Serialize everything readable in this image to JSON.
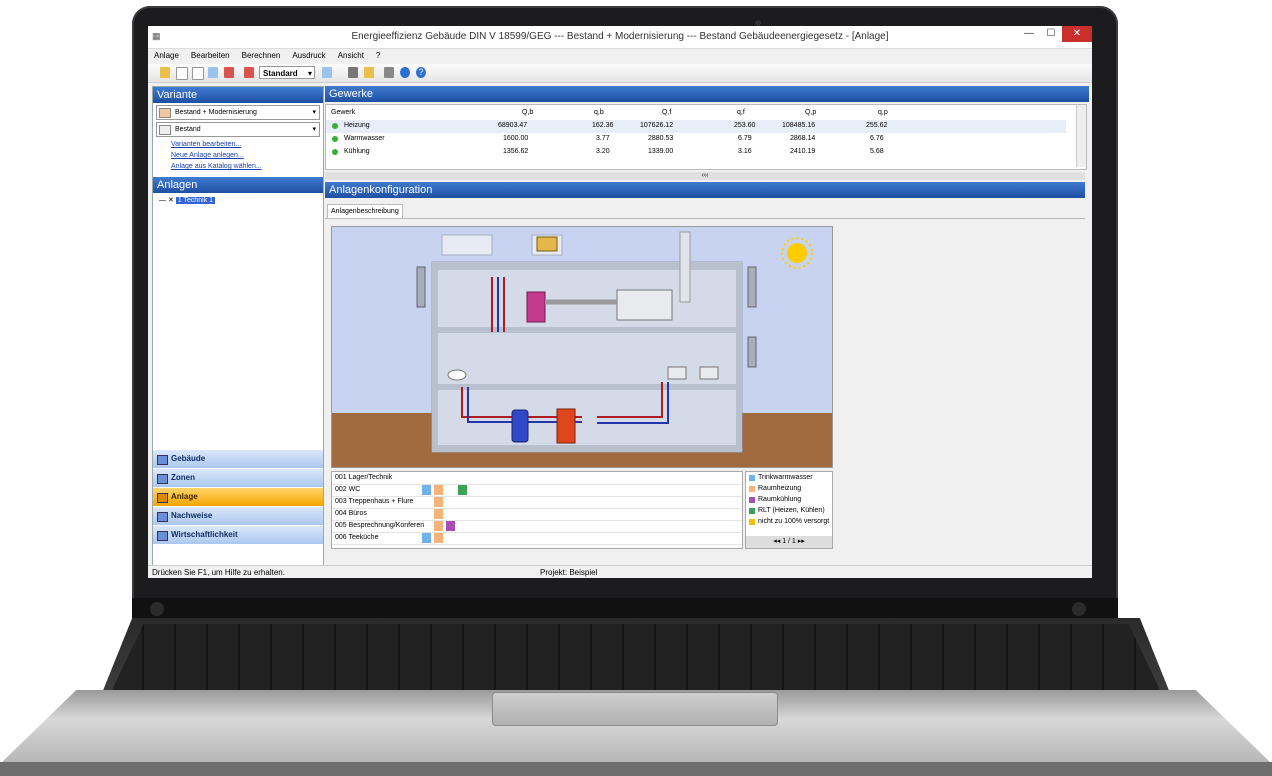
{
  "window": {
    "title": "Energieeffizienz Gebäude DIN V 18599/GEG --- Bestand + Modernisierung --- Bestand Gebäudeenergiegesetz - [Anlage]",
    "minimize": "—",
    "maximize": "☐",
    "close": "✕"
  },
  "menu": [
    "Anlage",
    "Bearbeiten",
    "Berechnen",
    "Ausdruck",
    "Ansicht",
    "?"
  ],
  "toolbar": {
    "combo_value": "Standard"
  },
  "left": {
    "variante_title": "Variante",
    "variante_select": "Bestand + Modernisierung",
    "bestand_select": "Bestand",
    "links": [
      "Varianten bearbeiten...",
      "Neue Anlage anlegen...",
      "Anlage aus Katalog wählen..."
    ],
    "anlagen_title": "Anlagen",
    "tree_node": "1 Technik 1",
    "nav": [
      "Gebäude",
      "Zonen",
      "Anlage",
      "Nachweise",
      "Wirtschaftlichkeit"
    ],
    "nav_active": "Anlage"
  },
  "gewerke": {
    "title": "Gewerke",
    "columns": [
      "Gewerk",
      "Q,b",
      "q,b",
      "Q,f",
      "q,f",
      "Q,p",
      "q,p"
    ],
    "rows": [
      {
        "name": "Heizung",
        "vals": [
          "68903.47",
          "162.36",
          "107626.12",
          "253.60",
          "108485.16",
          "255.62"
        ]
      },
      {
        "name": "Warmwasser",
        "vals": [
          "1600.00",
          "3.77",
          "2880.53",
          "6.79",
          "2868.14",
          "6.76"
        ]
      },
      {
        "name": "Kühlung",
        "vals": [
          "1356.62",
          "3.20",
          "1339.00",
          "3.16",
          "2410.19",
          "5.68"
        ]
      }
    ],
    "splitter": "‹‹‹"
  },
  "konfig": {
    "title": "Anlagenkonfiguration",
    "tab": "Anlagenbeschreibung"
  },
  "zones": [
    {
      "name": "001 Lager/Technik",
      "cells": []
    },
    {
      "name": "002 WC",
      "cells": [
        "tw",
        "rh",
        "",
        "",
        "rlt"
      ]
    },
    {
      "name": "003 Treppenhaus + Flure",
      "cells": [
        "",
        "rh"
      ]
    },
    {
      "name": "004 Büros",
      "cells": [
        "",
        "rh"
      ]
    },
    {
      "name": "005 Besprechnung/Konferen",
      "cells": [
        "",
        "rh",
        "rk"
      ]
    },
    {
      "name": "006 Teeküche",
      "cells": [
        "tw",
        "rh"
      ]
    }
  ],
  "legend": {
    "items": [
      {
        "label": "Trinkwarmwasser",
        "color": "#6fb3ea"
      },
      {
        "label": "Raumheizung",
        "color": "#f7b27a"
      },
      {
        "label": "Raumkühlung",
        "color": "#a84fb5"
      },
      {
        "label": "RLT (Heizen, Kühlen)",
        "color": "#3aa35a"
      },
      {
        "label": "nicht zu 100% versorgt",
        "color": "#f2c200"
      }
    ],
    "pager": "1 / 1"
  },
  "status": {
    "left": "Drücken Sie F1, um Hilfe zu erhalten.",
    "center": "Projekt: Beispiel"
  }
}
